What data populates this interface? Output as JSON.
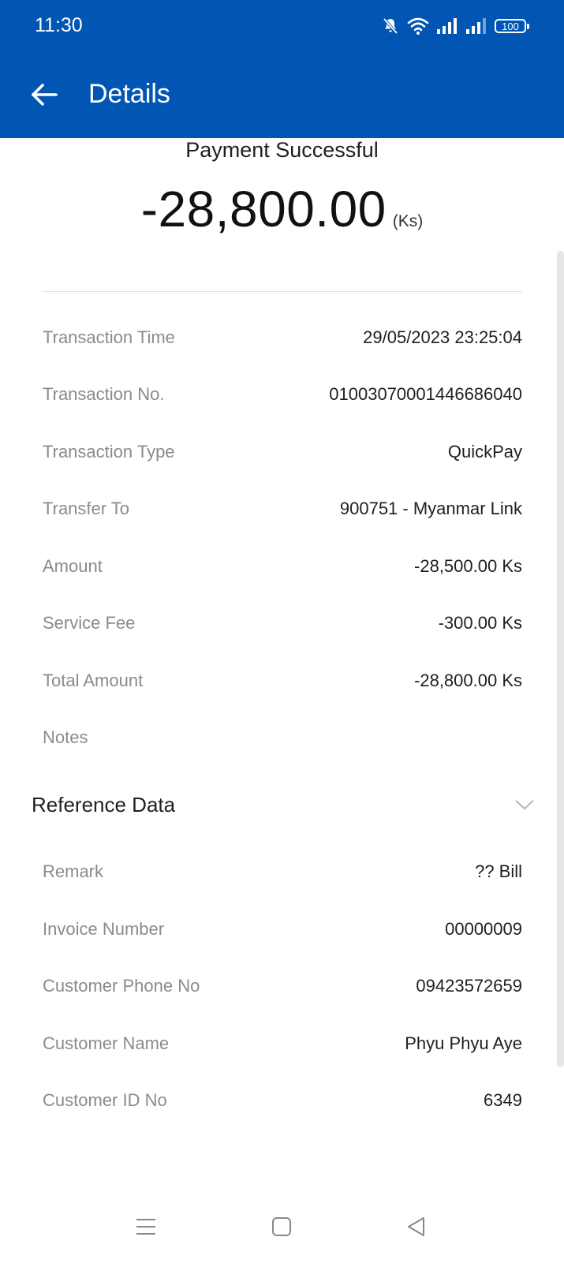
{
  "status_bar": {
    "time": "11:30",
    "battery": "100",
    "icons": [
      "bell-off-icon",
      "wifi-icon",
      "signal-icon",
      "signal-icon",
      "battery-icon"
    ]
  },
  "header": {
    "title": "Details",
    "back_icon": "arrow-left-icon",
    "background_color": "#0155b3"
  },
  "summary": {
    "status": "Payment Successful",
    "amount": "-28,800.00",
    "unit": "(Ks)"
  },
  "details": [
    {
      "label": "Transaction Time",
      "value": "29/05/2023 23:25:04"
    },
    {
      "label": "Transaction No.",
      "value": "01003070001446686040"
    },
    {
      "label": "Transaction Type",
      "value": "QuickPay"
    },
    {
      "label": "Transfer To",
      "value": "900751 - Myanmar Link"
    },
    {
      "label": "Amount",
      "value": "-28,500.00 Ks"
    },
    {
      "label": "Service Fee",
      "value": "-300.00 Ks"
    },
    {
      "label": "Total Amount",
      "value": "-28,800.00 Ks"
    },
    {
      "label": "Notes",
      "value": ""
    }
  ],
  "reference": {
    "title": "Reference Data",
    "toggle_icon": "chevron-down-icon",
    "items": [
      {
        "label": "Remark",
        "value": "?? Bill"
      },
      {
        "label": "Invoice Number",
        "value": "00000009"
      },
      {
        "label": "Customer Phone No",
        "value": "09423572659"
      },
      {
        "label": "Customer Name",
        "value": "Phyu Phyu Aye"
      },
      {
        "label": "Customer ID No",
        "value": "6349"
      }
    ]
  },
  "nav_bar": {
    "icons": [
      "menu-icon",
      "home-square-icon",
      "back-triangle-icon"
    ]
  }
}
